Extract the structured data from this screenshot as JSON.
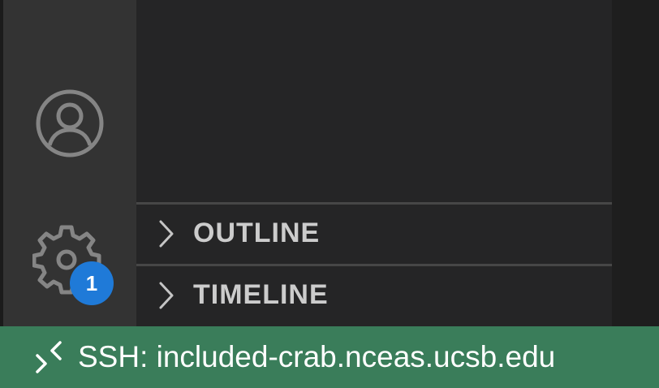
{
  "activity_bar": {
    "account_icon": "account-icon",
    "manage_icon": "gear-icon",
    "manage_badge": "1"
  },
  "sidebar": {
    "sections": [
      {
        "label": "OUTLINE",
        "icon": "chevron-right-icon",
        "expanded": false
      },
      {
        "label": "TIMELINE",
        "icon": "chevron-right-icon",
        "expanded": false
      }
    ]
  },
  "status_bar": {
    "remote_icon": "remote-connection-icon",
    "remote_label": "SSH: included-crab.nceas.ucsb.edu"
  },
  "colors": {
    "status_bar": "#3a7d5a",
    "badge": "#1f7ad8",
    "activity_bar": "#333333",
    "sidebar": "#252526"
  }
}
